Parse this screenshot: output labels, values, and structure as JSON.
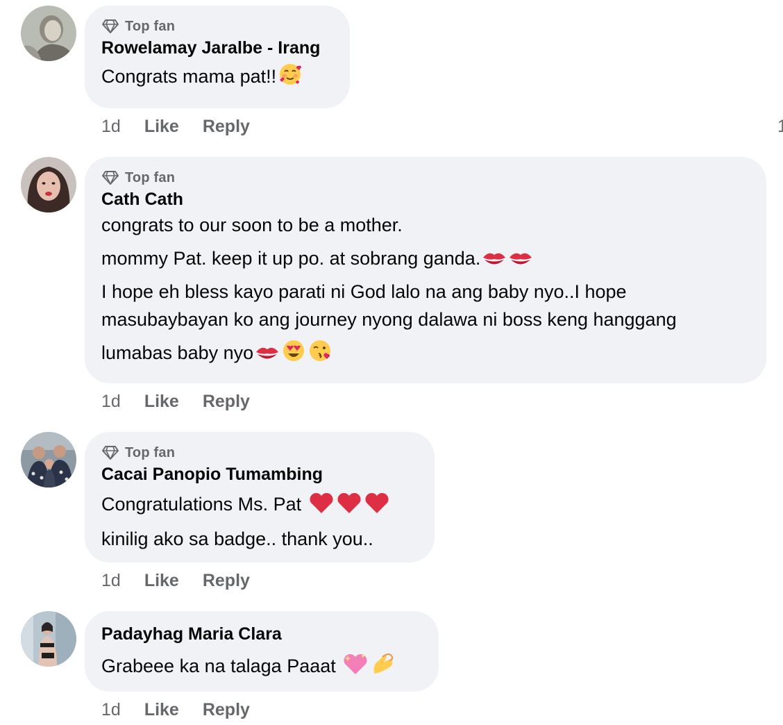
{
  "comments": [
    {
      "badge": "Top fan",
      "author": "Rowelamay Jaralbe - Irang",
      "lines": [
        "Congrats mama pat!!"
      ],
      "emoji_after": [
        [
          "smiling-face-with-hearts"
        ]
      ],
      "time": "1d",
      "like": "Like",
      "reply": "Reply"
    },
    {
      "badge": "Top fan",
      "author": "Cath Cath",
      "lines": [
        "congrats to our soon to be a mother.",
        "mommy Pat. keep it up po. at sobrang ganda.",
        "I hope eh bless kayo parati ni God lalo na ang baby nyo..I hope",
        "masubaybayan ko ang journey nyong dalawa ni boss keng hanggang",
        "lumabas baby nyo"
      ],
      "emoji_after": [
        [],
        [
          "kiss-mark",
          "kiss-mark"
        ],
        [],
        [],
        [
          "kiss-mark",
          "heart-eyes",
          "face-blowing-kiss"
        ]
      ],
      "time": "1d",
      "like": "Like",
      "reply": "Reply"
    },
    {
      "badge": "Top fan",
      "author": "Cacai Panopio Tumambing",
      "lines": [
        "Congratulations Ms. Pat ",
        "kinilig ako sa badge.. thank you.."
      ],
      "emoji_after": [
        [
          "red-heart",
          "red-heart",
          "red-heart"
        ],
        []
      ],
      "time": "1d",
      "like": "Like",
      "reply": "Reply"
    },
    {
      "author": "Padayhag Maria Clara",
      "lines": [
        "Grabeee ka na talaga Paaat "
      ],
      "emoji_after": [
        [
          "sparkling-heart",
          "pinching-hand"
        ]
      ],
      "time": "1d",
      "like": "Like",
      "reply": "Reply"
    }
  ],
  "edge_count": "1",
  "colors": {
    "bubble": "#f0f2f5",
    "meta_text": "#65676b",
    "text": "#050505"
  }
}
